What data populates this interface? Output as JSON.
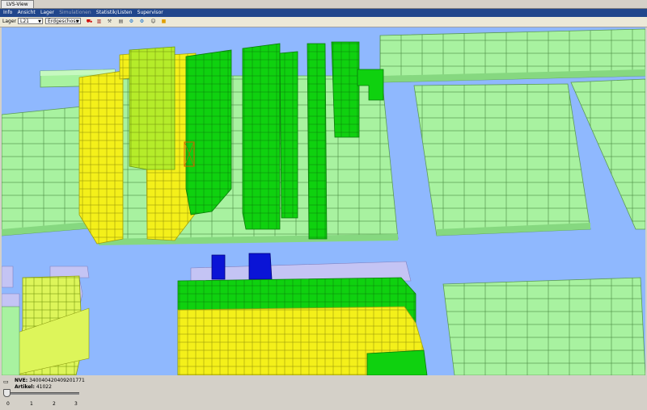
{
  "window": {
    "tab_title": "LVS-View"
  },
  "menu": [
    {
      "label": "Info",
      "enabled": true
    },
    {
      "label": "Ansicht",
      "enabled": true
    },
    {
      "label": "Lager",
      "enabled": true
    },
    {
      "label": "Simulationen",
      "enabled": false
    },
    {
      "label": "Statistik/Listen",
      "enabled": true
    },
    {
      "label": "Supervisor",
      "enabled": true
    }
  ],
  "toolbar": {
    "lager_label": "Lager",
    "lager_value": "L21",
    "floor_value": "Erdgeschoss",
    "icons": [
      "hand-truck-icon",
      "shelf-icon",
      "forklift-icon",
      "pallet-icon",
      "robot-icon",
      "gear-icon",
      "people-icon",
      "boxes-icon"
    ]
  },
  "status": {
    "nve_label": "NVE:",
    "nve_value": "340040420409201771",
    "artikel_label": "Artikel:",
    "artikel_value": "41022"
  },
  "slider": {
    "value": 0,
    "ticks": [
      "0",
      "1",
      "2",
      "3"
    ]
  },
  "colors": {
    "floor": "#8fb8fe",
    "empty_rack": "#a8f2a0",
    "green": "#0fd10f",
    "lime": "#b5ec2a",
    "yellow": "#f4f01a",
    "blue": "#0a14d6",
    "lavender": "#c4c4f4"
  }
}
